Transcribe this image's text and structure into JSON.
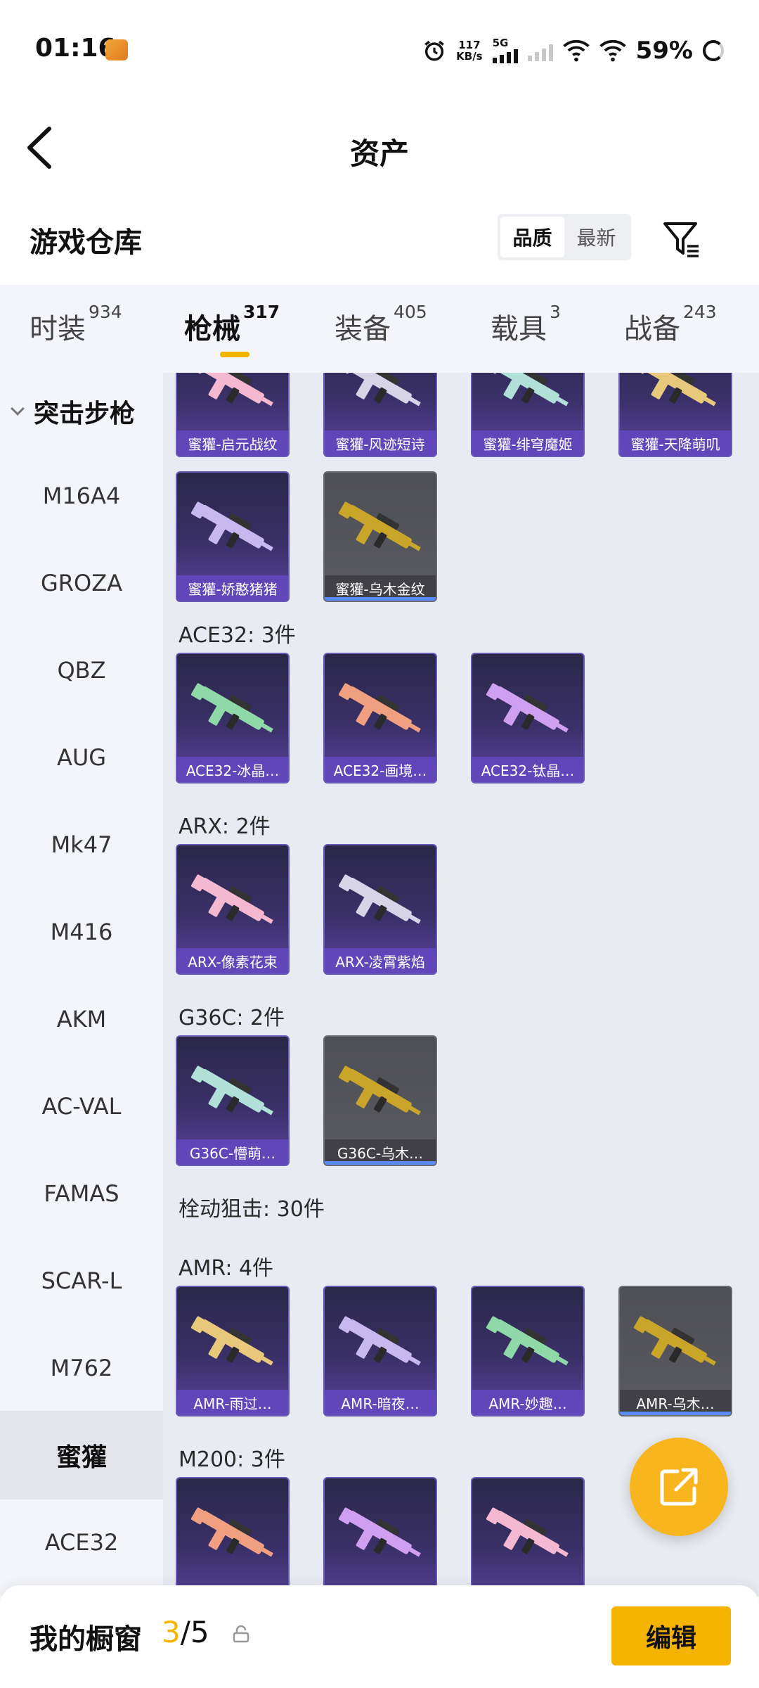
{
  "status_bar": {
    "time": "01:16",
    "net_speed_value": "117",
    "net_speed_unit": "KB/s",
    "network_type": "5G",
    "battery": "59%",
    "icons": [
      "alarm-icon",
      "signal-icon",
      "wifi-icon",
      "battery-icon"
    ]
  },
  "header": {
    "title": "资产"
  },
  "warehouse": {
    "title": "游戏仓库",
    "sort_options": [
      "品质",
      "最新"
    ],
    "active_sort": "品质"
  },
  "tabs": [
    {
      "label": "时装",
      "count": "934"
    },
    {
      "label": "枪械",
      "count": "317",
      "active": true
    },
    {
      "label": "装备",
      "count": "405"
    },
    {
      "label": "载具",
      "count": "3"
    },
    {
      "label": "战备",
      "count": "243"
    }
  ],
  "sidebar": {
    "group": "突击步枪",
    "items": [
      "M16A4",
      "GROZA",
      "QBZ",
      "AUG",
      "Mk47",
      "M416",
      "AKM",
      "AC-VAL",
      "FAMAS",
      "SCAR-L",
      "M762",
      "蜜獾",
      "ACE32"
    ],
    "active": "蜜獾"
  },
  "content": {
    "top_row": [
      "蜜獾-启元战纹",
      "蜜獾-风迹短诗",
      "蜜獾-绯穹魔姬",
      "蜜獾-天降萌叽"
    ],
    "honey_badger_row": [
      {
        "name": "蜜獾-娇憨猪猪",
        "rarity": "purple"
      },
      {
        "name": "蜜獾-乌木金纹",
        "rarity": "grey"
      }
    ],
    "sections": [
      {
        "title": "ACE32: 3件",
        "items": [
          {
            "name": "ACE32-冰晶…",
            "rarity": "purple"
          },
          {
            "name": "ACE32-画境…",
            "rarity": "purple"
          },
          {
            "name": "ACE32-钛晶…",
            "rarity": "purple"
          }
        ]
      },
      {
        "title": "ARX: 2件",
        "items": [
          {
            "name": "ARX-像素花束",
            "rarity": "purple"
          },
          {
            "name": "ARX-凌霄紫焰",
            "rarity": "purple"
          }
        ]
      },
      {
        "title": "G36C: 2件",
        "items": [
          {
            "name": "G36C-懵萌…",
            "rarity": "purple"
          },
          {
            "name": "G36C-乌木…",
            "rarity": "grey"
          }
        ]
      },
      {
        "title": "栓动狙击: 30件",
        "items": []
      },
      {
        "title": "AMR: 4件",
        "items": [
          {
            "name": "AMR-雨过…",
            "rarity": "purple"
          },
          {
            "name": "AMR-暗夜…",
            "rarity": "purple"
          },
          {
            "name": "AMR-妙趣…",
            "rarity": "purple"
          },
          {
            "name": "AMR-乌木…",
            "rarity": "grey"
          }
        ]
      },
      {
        "title": "M200: 3件",
        "items": [
          {
            "name": "",
            "rarity": "purple"
          },
          {
            "name": "",
            "rarity": "purple"
          },
          {
            "name": "",
            "rarity": "purple"
          }
        ]
      }
    ]
  },
  "bottom_bar": {
    "label": "我的橱窗",
    "current": "3",
    "separator": "/",
    "total": "5",
    "edit_label": "编辑"
  },
  "colors": {
    "accent": "#f5b400",
    "card_purple": "#5a43a0",
    "card_grey": "#5a5b61",
    "highlight_blue": "#5b8cff"
  }
}
